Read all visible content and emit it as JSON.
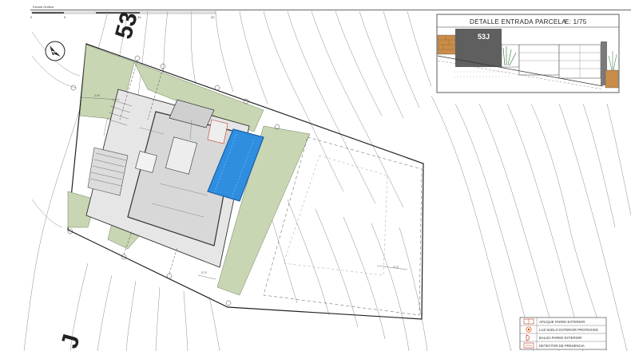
{
  "scale_bar": {
    "label": "Escala Gráfica",
    "ticks": [
      "0",
      "5",
      "10",
      "20"
    ]
  },
  "north_arrow": {
    "letter": "N"
  },
  "plot_labels": {
    "top": "53",
    "bottom": "J"
  },
  "detail": {
    "title": "DETALLE ENTRADA PARCELA",
    "scale": "E: 1/75",
    "plate": "53J"
  },
  "dimensions": [
    "3.00",
    "5.70",
    "3.70"
  ],
  "legend": [
    {
      "symbol": "wall-light",
      "label": "APLIQUE PARED EXTERIOR",
      "color": "#c0392b"
    },
    {
      "symbol": "floor-light",
      "label": "LUZ SUELO EXTERIOR PROTEGIDO",
      "color": "#d35400"
    },
    {
      "symbol": "bollard",
      "label": "BALIZA PARED EXTERIOR",
      "color": "#c0392b"
    },
    {
      "symbol": "motion-sensor",
      "label": "DETECTOR DE PRESENCIA",
      "color": "#c0392b"
    }
  ],
  "colors": {
    "garden": "#c9d6b4",
    "pool": "#2f8ee0",
    "pool_edge": "#1d5fa8",
    "wall": "#9a9a9a",
    "plate_bg": "#5f5f5f"
  }
}
